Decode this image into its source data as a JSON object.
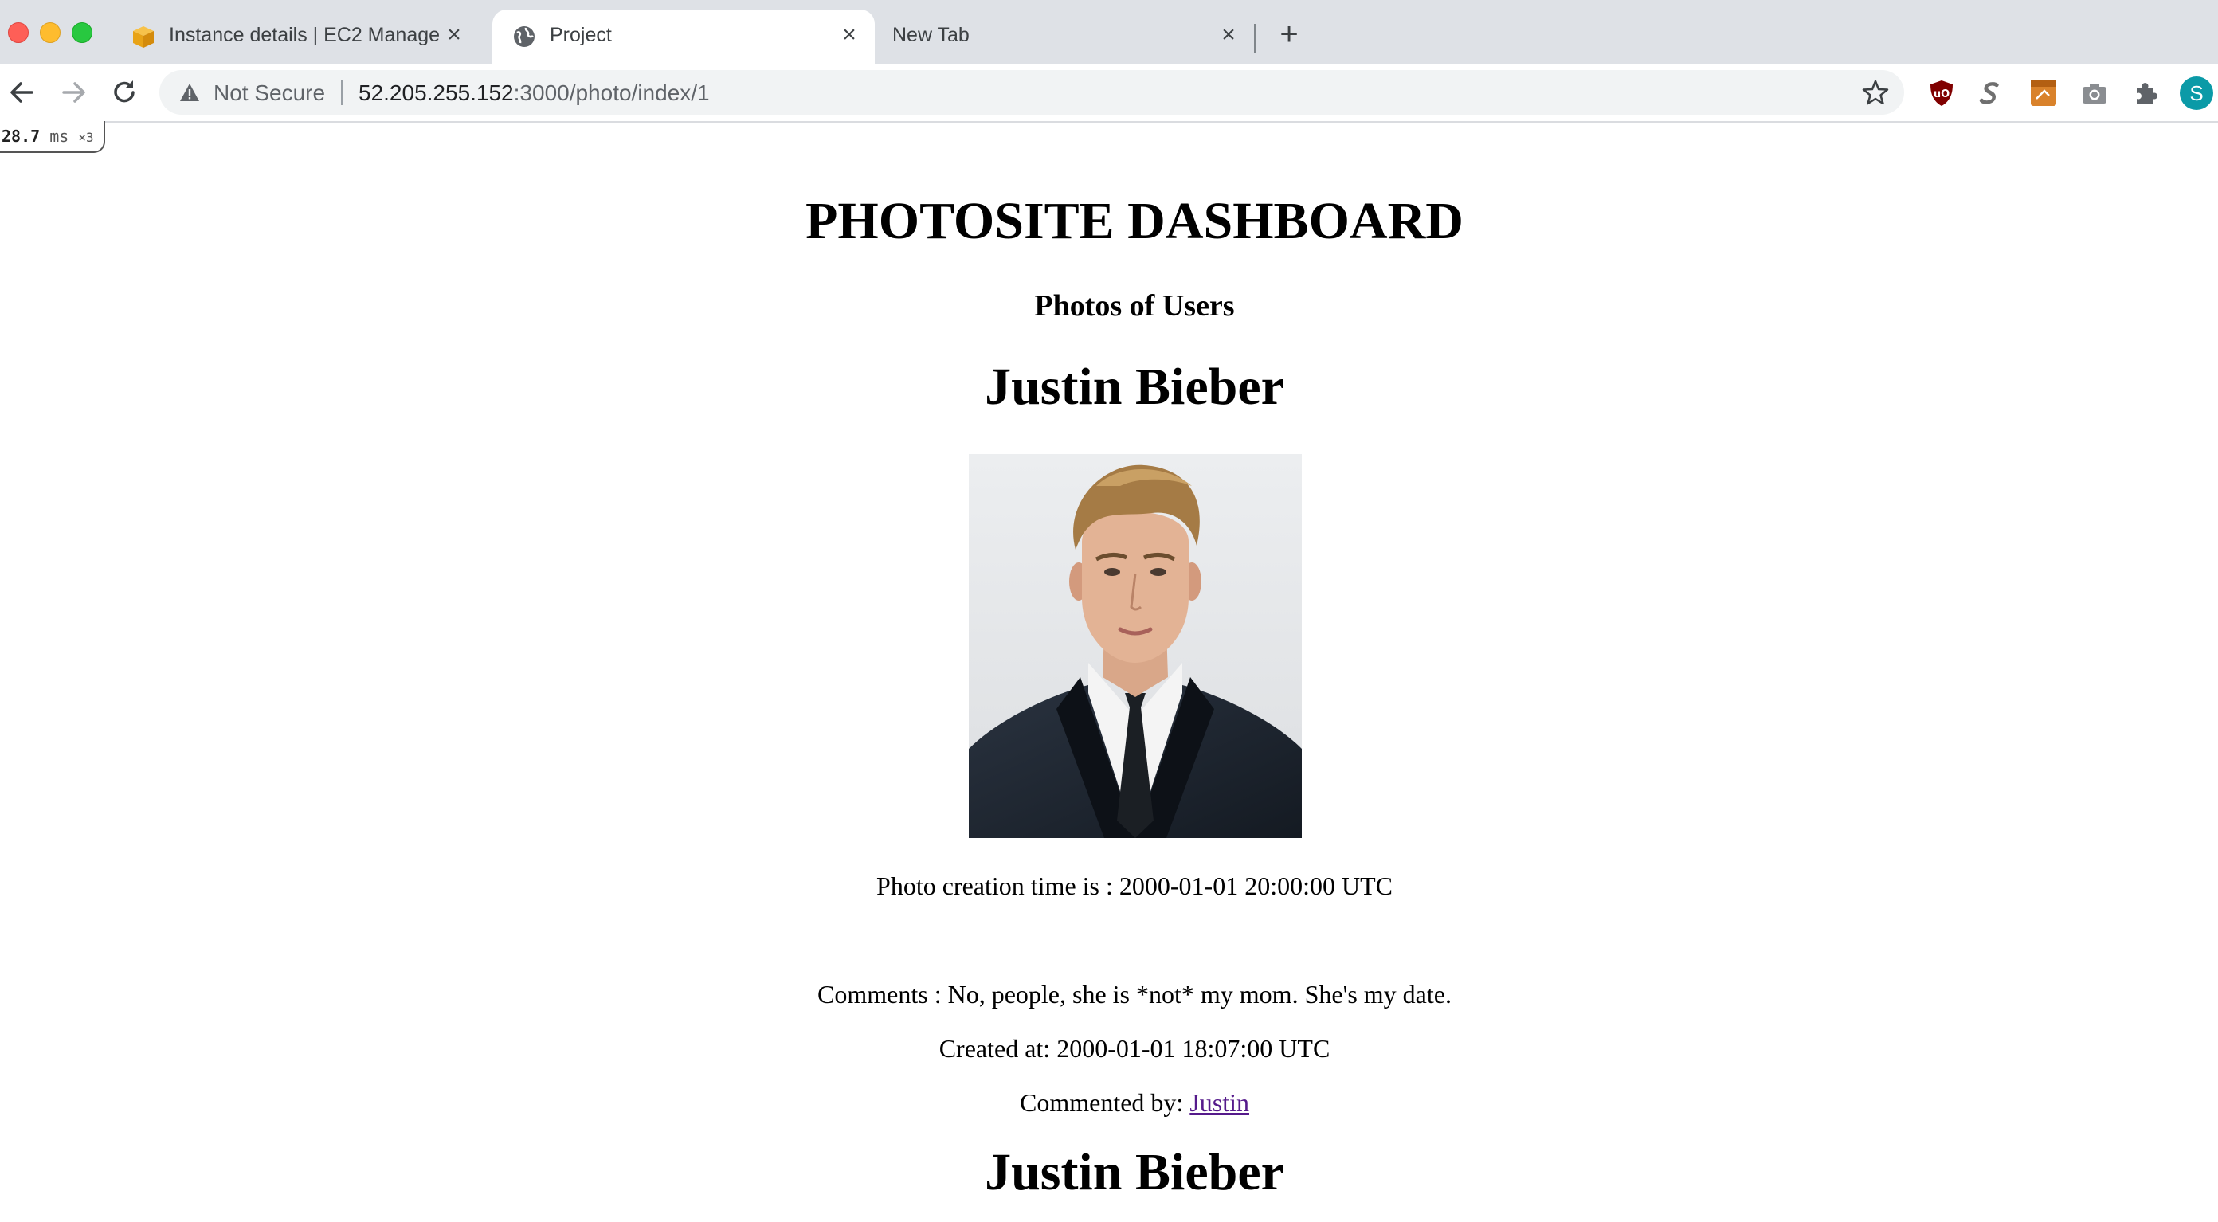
{
  "browser": {
    "tabs": [
      {
        "title": "Instance details | EC2 Manager",
        "icon": "aws-box-icon",
        "active": false
      },
      {
        "title": "Project",
        "icon": "globe-icon",
        "active": true
      },
      {
        "title": "New Tab",
        "icon": "",
        "active": false
      }
    ],
    "close_glyph": "×",
    "new_tab_glyph": "+",
    "address_bar": {
      "security_label": "Not Secure",
      "url_host": "52.205.255.152",
      "url_path": ":3000/photo/index/1"
    },
    "profile_initial": "S",
    "extensions": [
      "ublock-origin-icon",
      "s-extension-icon",
      "notes-extension-icon",
      "camera-icon",
      "puzzle-icon"
    ]
  },
  "perf_overlay": {
    "value": "28.7",
    "unit": "ms",
    "count": "×3"
  },
  "page": {
    "title": "PHOTOSITE DASHBOARD",
    "subtitle": "Photos of Users",
    "photos": [
      {
        "user_name": "Justin Bieber",
        "image_alt": "portrait of Justin Bieber",
        "creation_time": "Photo creation time is : 2000-01-01 20:00:00 UTC",
        "comment": "Comments : No, people, she is *not* my mom. She's my date.",
        "comment_created": "Created at: 2000-01-01 18:07:00 UTC",
        "commented_by_label": "Commented by: ",
        "commenter": "Justin"
      },
      {
        "user_name": "Justin Bieber"
      }
    ]
  },
  "colors": {
    "tab_strip": "#dee1e6",
    "link_visited": "#551a8b",
    "profile": "#0b9aa7"
  }
}
